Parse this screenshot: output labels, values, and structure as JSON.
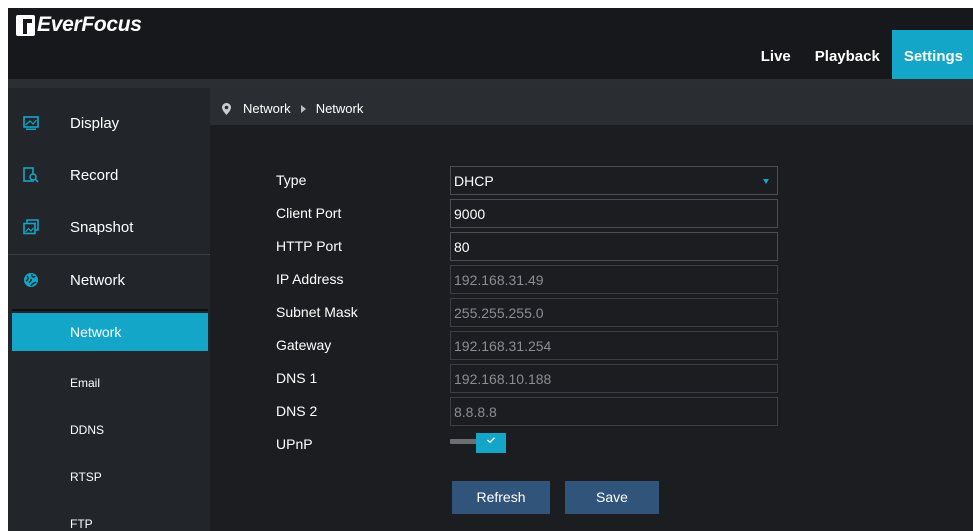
{
  "brand": {
    "name": "EverFocus"
  },
  "topnav": [
    {
      "label": "Live",
      "active": false
    },
    {
      "label": "Playback",
      "active": false
    },
    {
      "label": "Settings",
      "active": true
    }
  ],
  "sidebar": {
    "items": [
      {
        "label": "Display",
        "icon": "monitor-icon"
      },
      {
        "label": "Record",
        "icon": "record-search-icon"
      },
      {
        "label": "Snapshot",
        "icon": "snapshot-icon"
      },
      {
        "label": "Network",
        "icon": "globe-icon"
      }
    ],
    "subitems": [
      {
        "label": "Network",
        "active": true
      },
      {
        "label": "Email",
        "active": false
      },
      {
        "label": "DDNS",
        "active": false
      },
      {
        "label": "RTSP",
        "active": false
      },
      {
        "label": "FTP",
        "active": false
      }
    ]
  },
  "breadcrumb": [
    "Network",
    "Network"
  ],
  "form": {
    "type": {
      "label": "Type",
      "value": "DHCP"
    },
    "client_port": {
      "label": "Client Port",
      "value": "9000"
    },
    "http_port": {
      "label": "HTTP Port",
      "value": "80"
    },
    "ip_address": {
      "label": "IP Address",
      "value": "192.168.31.49"
    },
    "subnet_mask": {
      "label": "Subnet Mask",
      "value": "255.255.255.0"
    },
    "gateway": {
      "label": "Gateway",
      "value": "192.168.31.254"
    },
    "dns1": {
      "label": "DNS 1",
      "value": "192.168.10.188"
    },
    "dns2": {
      "label": "DNS 2",
      "value": "8.8.8.8"
    },
    "upnp": {
      "label": "UPnP",
      "enabled": true
    }
  },
  "buttons": {
    "refresh": "Refresh",
    "save": "Save"
  },
  "colors": {
    "accent": "#14a6c8",
    "button": "#31557a",
    "background": "#1b1d20"
  }
}
